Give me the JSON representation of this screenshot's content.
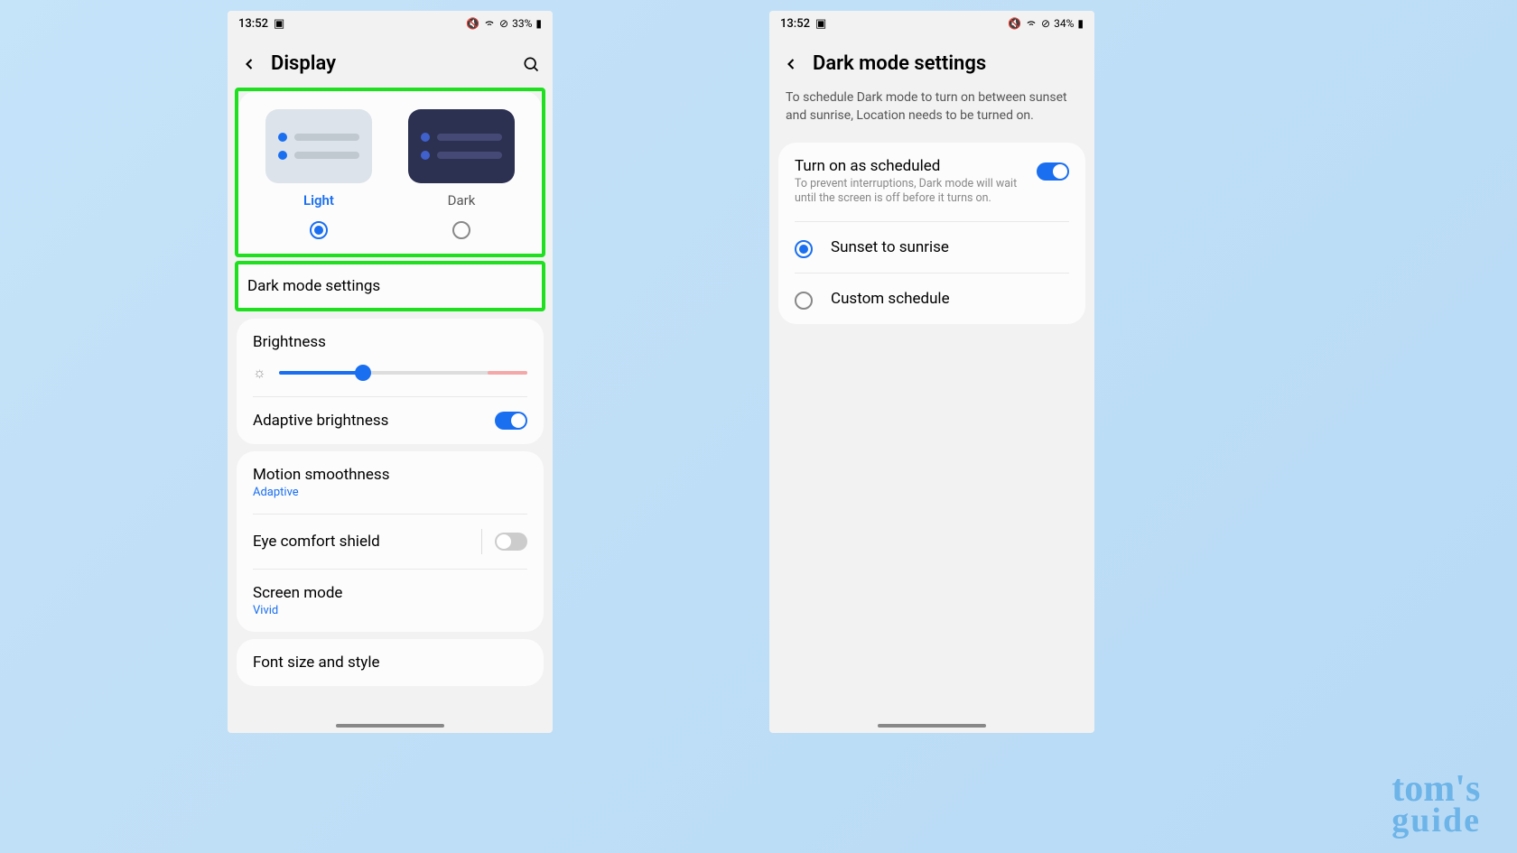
{
  "phone_left": {
    "status": {
      "time": "13:52",
      "battery": "33%"
    },
    "title": "Display",
    "theme": {
      "light_label": "Light",
      "dark_label": "Dark",
      "selected": "light"
    },
    "dark_mode_settings_label": "Dark mode settings",
    "brightness": {
      "label": "Brightness",
      "value_pct": 34
    },
    "adaptive_brightness": {
      "label": "Adaptive brightness",
      "on": true
    },
    "motion_smoothness": {
      "label": "Motion smoothness",
      "value": "Adaptive"
    },
    "eye_comfort": {
      "label": "Eye comfort shield",
      "on": false
    },
    "screen_mode": {
      "label": "Screen mode",
      "value": "Vivid"
    },
    "font": {
      "label": "Font size and style"
    }
  },
  "phone_right": {
    "status": {
      "time": "13:52",
      "battery": "34%"
    },
    "title": "Dark mode settings",
    "info": "To schedule Dark mode to turn on between sunset and sunrise, Location needs to be turned on.",
    "scheduled": {
      "label": "Turn on as scheduled",
      "sub": "To prevent interruptions, Dark mode will wait until the screen is off before it turns on.",
      "on": true
    },
    "options": {
      "sunset": "Sunset to sunrise",
      "custom": "Custom schedule",
      "selected": "sunset"
    }
  },
  "watermark": {
    "line1": "tom's",
    "line2": "guide"
  }
}
